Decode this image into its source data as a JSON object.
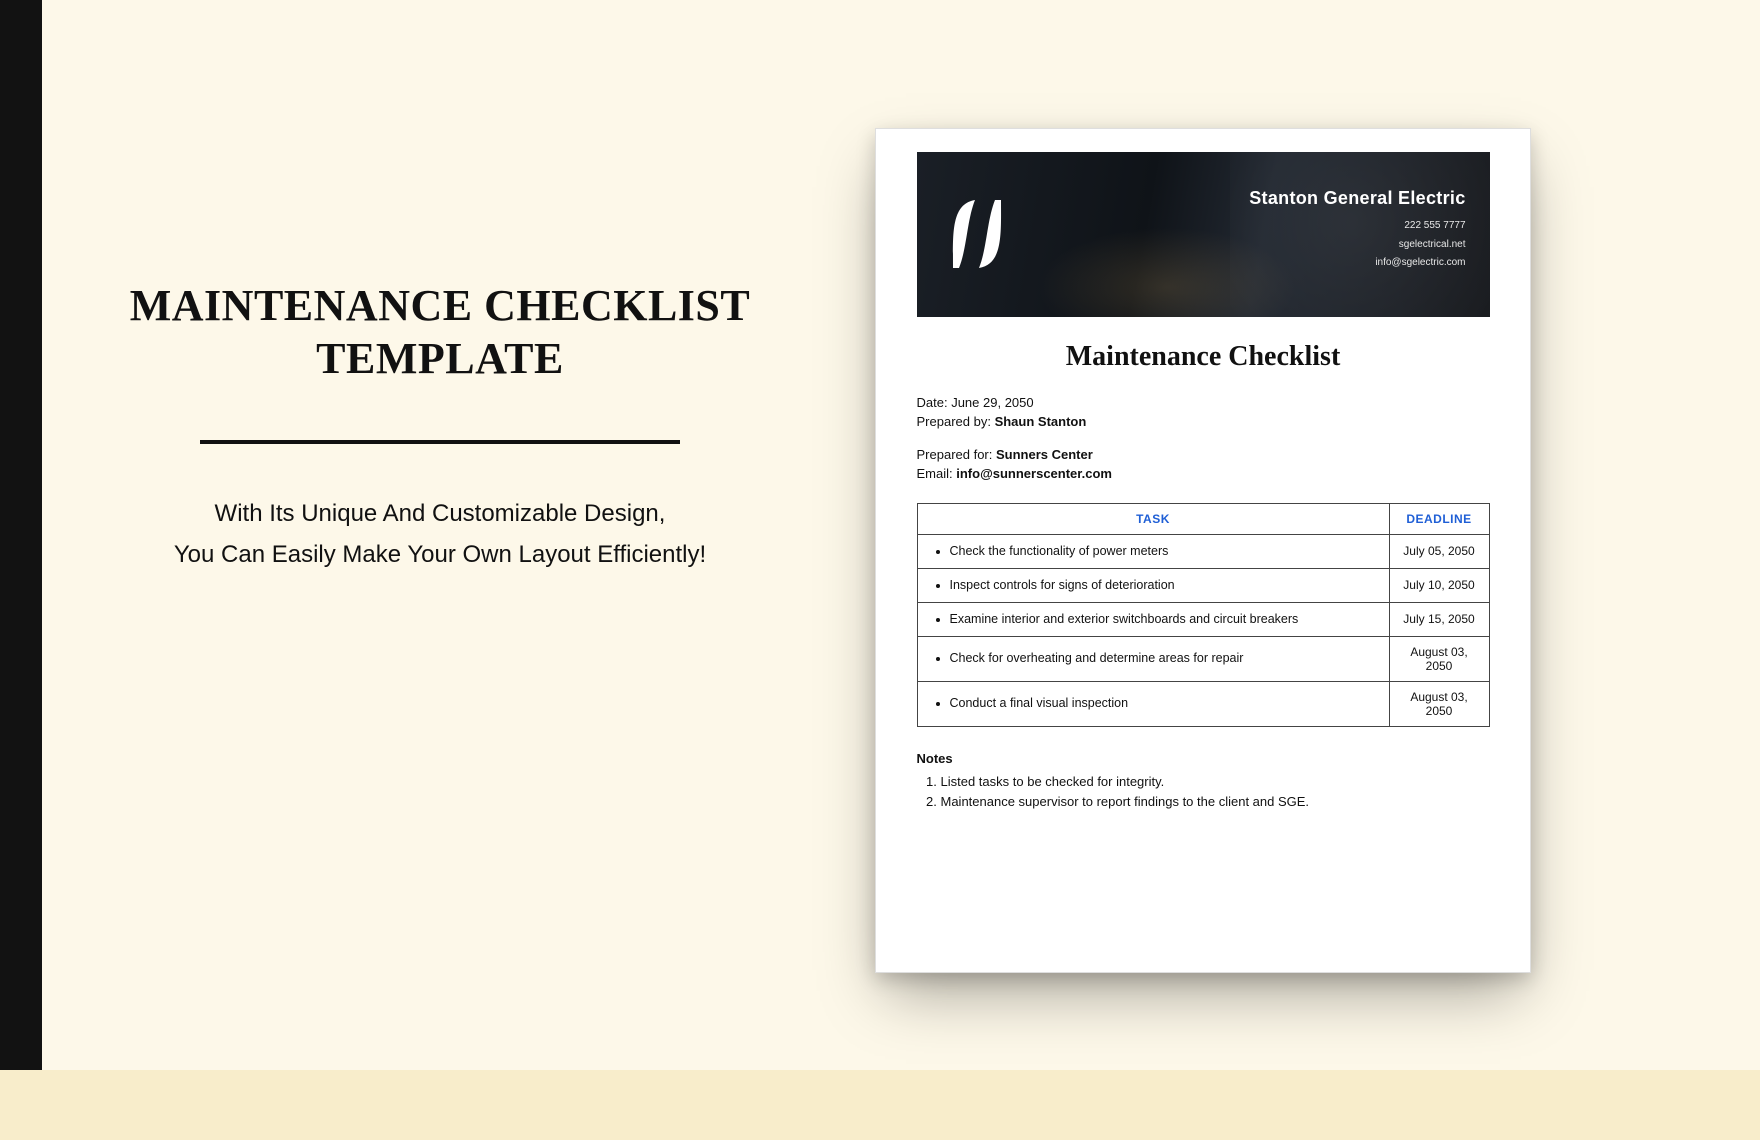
{
  "left": {
    "title_line1": "MAINTENANCE CHECKLIST",
    "title_line2": "TEMPLATE",
    "subtitle_line1": "With Its Unique And Customizable Design,",
    "subtitle_line2": "You Can Easily Make Your Own Layout Efficiently!"
  },
  "doc": {
    "company": {
      "name": "Stanton General Electric",
      "phone": "222 555 7777",
      "website": "sgelectrical.net",
      "email": "info@sgelectric.com"
    },
    "title": "Maintenance Checklist",
    "meta": {
      "date_label": "Date:",
      "date_value": "June 29, 2050",
      "prepared_by_label": "Prepared by:",
      "prepared_by_value": "Shaun Stanton",
      "prepared_for_label": "Prepared for:",
      "prepared_for_value": "Sunners Center",
      "email_label": "Email:",
      "email_value": "info@sunnerscenter.com"
    },
    "table": {
      "head_task": "TASK",
      "head_deadline": "DEADLINE",
      "rows": [
        {
          "task": "Check the functionality of power meters",
          "deadline": "July 05, 2050"
        },
        {
          "task": "Inspect controls for signs of deterioration",
          "deadline": "July 10, 2050"
        },
        {
          "task": "Examine interior and exterior switchboards and circuit breakers",
          "deadline": "July 15, 2050"
        },
        {
          "task": "Check for overheating and determine areas for repair",
          "deadline": "August 03, 2050"
        },
        {
          "task": "Conduct a final visual inspection",
          "deadline": "August 03, 2050"
        }
      ]
    },
    "notes": {
      "heading": "Notes",
      "items": [
        "Listed tasks to be checked for integrity.",
        "Maintenance supervisor to report findings to the client and SGE."
      ]
    }
  }
}
